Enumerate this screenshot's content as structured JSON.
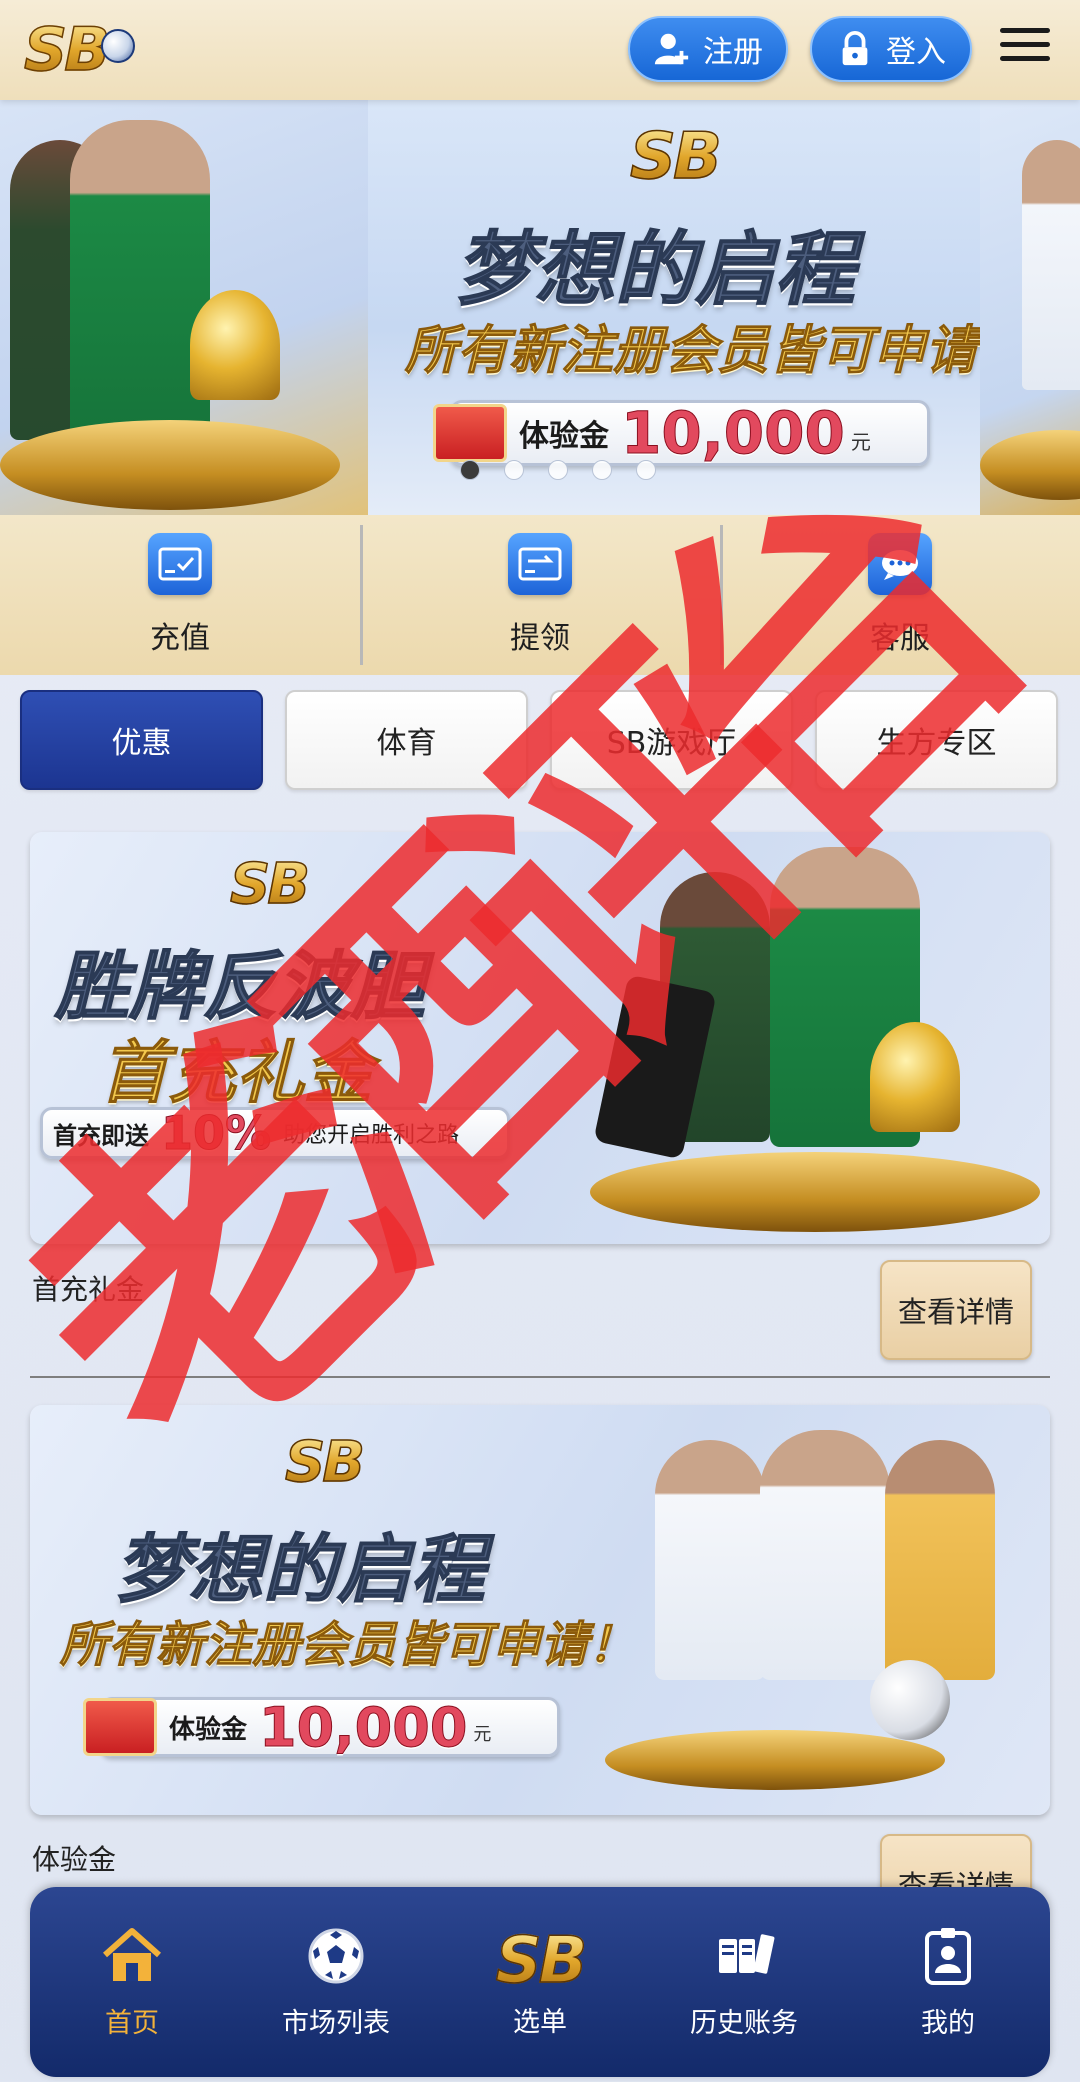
{
  "header": {
    "logo": "SB",
    "register_label": "注册",
    "login_label": "登入"
  },
  "carousel": {
    "title": "梦想的启程",
    "subtitle": "所有新注册会员皆可申请！",
    "badge_label": "体验金",
    "badge_amount": "10,000",
    "badge_unit": "元",
    "slide_count": 5,
    "active_slide": 0
  },
  "quick_actions": [
    {
      "label": "充值",
      "icon": "deposit-card-icon"
    },
    {
      "label": "提领",
      "icon": "withdraw-card-icon"
    },
    {
      "label": "客服",
      "icon": "chat-support-icon"
    }
  ],
  "tabs": [
    {
      "label": "优惠",
      "active": true
    },
    {
      "label": "体育",
      "active": false
    },
    {
      "label": "SB游戏厅",
      "active": false
    },
    {
      "label": "生方专区",
      "active": false
    }
  ],
  "promos": [
    {
      "title": "胜牌反波胆",
      "subtitle": "首充礼金",
      "badge_label": "首充即送",
      "badge_amount": "10%",
      "badge_tail": "助您开启胜利之路",
      "name": "首充礼金",
      "detail_label": "查看详情"
    },
    {
      "title": "梦想的启程",
      "subtitle": "所有新注册会员皆可申请！",
      "badge_label": "体验金",
      "badge_amount": "10,000",
      "badge_unit": "元",
      "name": "体验金",
      "detail_label": "查看详情"
    }
  ],
  "bottom_nav": [
    {
      "label": "首页",
      "icon": "home-icon",
      "active": true
    },
    {
      "label": "市场列表",
      "icon": "soccer-ball-icon",
      "active": false
    },
    {
      "label": "选单",
      "icon": "sb-logo-icon",
      "active": false
    },
    {
      "label": "历史账务",
      "icon": "tickets-icon",
      "active": false
    },
    {
      "label": "我的",
      "icon": "id-badge-icon",
      "active": false
    }
  ],
  "watermark": {
    "chars": [
      "老",
      "酒",
      "评",
      "台"
    ],
    "color": "#ec2c2e"
  },
  "colors": {
    "header_bg": "#f2e4c5",
    "accent_blue": "#1d63d8",
    "tab_active": "#233f9f",
    "nav_bg": "#1f3880",
    "nav_active": "#f3b23a",
    "gold": "#e1a62b"
  }
}
